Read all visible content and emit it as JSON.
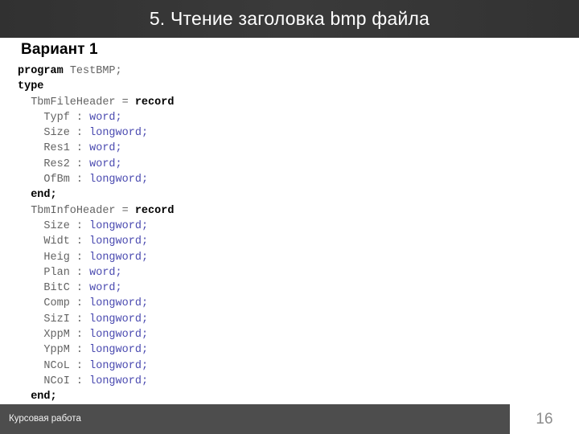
{
  "slide": {
    "title": "5. Чтение заголовка bmp файла",
    "variant_heading": "Вариант 1",
    "footer_label": "Курсовая работа",
    "slide_number": "16",
    "colors": {
      "header_bg": "#333333",
      "footer_bar_bg": "#4d4d4d",
      "title_text": "#ffffff",
      "keyword": "#000000",
      "type_token": "#4a4ab0",
      "identifier": "#636363",
      "slide_number_text": "#8c8c8c"
    }
  },
  "code": {
    "language": "pascal",
    "lines": [
      {
        "indent": 0,
        "tokens": [
          {
            "t": "program",
            "k": "kw"
          },
          {
            "t": " ",
            "k": "sp"
          },
          {
            "t": "TestBMP;",
            "k": "id"
          }
        ]
      },
      {
        "indent": 0,
        "tokens": [
          {
            "t": "type",
            "k": "kw"
          }
        ]
      },
      {
        "indent": 1,
        "tokens": [
          {
            "t": "TbmFileHeader = ",
            "k": "id"
          },
          {
            "t": "record",
            "k": "kw"
          }
        ]
      },
      {
        "indent": 2,
        "tokens": [
          {
            "t": "Typf : ",
            "k": "id"
          },
          {
            "t": "word",
            "k": "type"
          },
          {
            "t": ";",
            "k": "type"
          }
        ]
      },
      {
        "indent": 2,
        "tokens": [
          {
            "t": "Size : ",
            "k": "id"
          },
          {
            "t": "longword",
            "k": "type"
          },
          {
            "t": ";",
            "k": "type"
          }
        ]
      },
      {
        "indent": 2,
        "tokens": [
          {
            "t": "Res1 : ",
            "k": "id"
          },
          {
            "t": "word",
            "k": "type"
          },
          {
            "t": ";",
            "k": "type"
          }
        ]
      },
      {
        "indent": 2,
        "tokens": [
          {
            "t": "Res2 : ",
            "k": "id"
          },
          {
            "t": "word",
            "k": "type"
          },
          {
            "t": ";",
            "k": "type"
          }
        ]
      },
      {
        "indent": 2,
        "tokens": [
          {
            "t": "OfBm : ",
            "k": "id"
          },
          {
            "t": "longword",
            "k": "type"
          },
          {
            "t": ";",
            "k": "type"
          }
        ]
      },
      {
        "indent": 1,
        "tokens": [
          {
            "t": "end;",
            "k": "kw"
          }
        ]
      },
      {
        "indent": 1,
        "tokens": [
          {
            "t": "TbmInfoHeader = ",
            "k": "id"
          },
          {
            "t": "record",
            "k": "kw"
          }
        ]
      },
      {
        "indent": 2,
        "tokens": [
          {
            "t": "Size : ",
            "k": "id"
          },
          {
            "t": "longword",
            "k": "type"
          },
          {
            "t": ";",
            "k": "type"
          }
        ]
      },
      {
        "indent": 2,
        "tokens": [
          {
            "t": "Widt : ",
            "k": "id"
          },
          {
            "t": "longword",
            "k": "type"
          },
          {
            "t": ";",
            "k": "type"
          }
        ]
      },
      {
        "indent": 2,
        "tokens": [
          {
            "t": "Heig : ",
            "k": "id"
          },
          {
            "t": "longword",
            "k": "type"
          },
          {
            "t": ";",
            "k": "type"
          }
        ]
      },
      {
        "indent": 2,
        "tokens": [
          {
            "t": "Plan : ",
            "k": "id"
          },
          {
            "t": "word",
            "k": "type"
          },
          {
            "t": ";",
            "k": "type"
          }
        ]
      },
      {
        "indent": 2,
        "tokens": [
          {
            "t": "BitC : ",
            "k": "id"
          },
          {
            "t": "word",
            "k": "type"
          },
          {
            "t": ";",
            "k": "type"
          }
        ]
      },
      {
        "indent": 2,
        "tokens": [
          {
            "t": "Comp : ",
            "k": "id"
          },
          {
            "t": "longword",
            "k": "type"
          },
          {
            "t": ";",
            "k": "type"
          }
        ]
      },
      {
        "indent": 2,
        "tokens": [
          {
            "t": "SizI : ",
            "k": "id"
          },
          {
            "t": "longword",
            "k": "type"
          },
          {
            "t": ";",
            "k": "type"
          }
        ]
      },
      {
        "indent": 2,
        "tokens": [
          {
            "t": "XppM : ",
            "k": "id"
          },
          {
            "t": "longword",
            "k": "type"
          },
          {
            "t": ";",
            "k": "type"
          }
        ]
      },
      {
        "indent": 2,
        "tokens": [
          {
            "t": "YppM : ",
            "k": "id"
          },
          {
            "t": "longword",
            "k": "type"
          },
          {
            "t": ";",
            "k": "type"
          }
        ]
      },
      {
        "indent": 2,
        "tokens": [
          {
            "t": "NCoL : ",
            "k": "id"
          },
          {
            "t": "longword",
            "k": "type"
          },
          {
            "t": ";",
            "k": "type"
          }
        ]
      },
      {
        "indent": 2,
        "tokens": [
          {
            "t": "NCoI : ",
            "k": "id"
          },
          {
            "t": "longword",
            "k": "type"
          },
          {
            "t": ";",
            "k": "type"
          }
        ]
      },
      {
        "indent": 1,
        "tokens": [
          {
            "t": "end;",
            "k": "kw"
          }
        ]
      }
    ]
  }
}
